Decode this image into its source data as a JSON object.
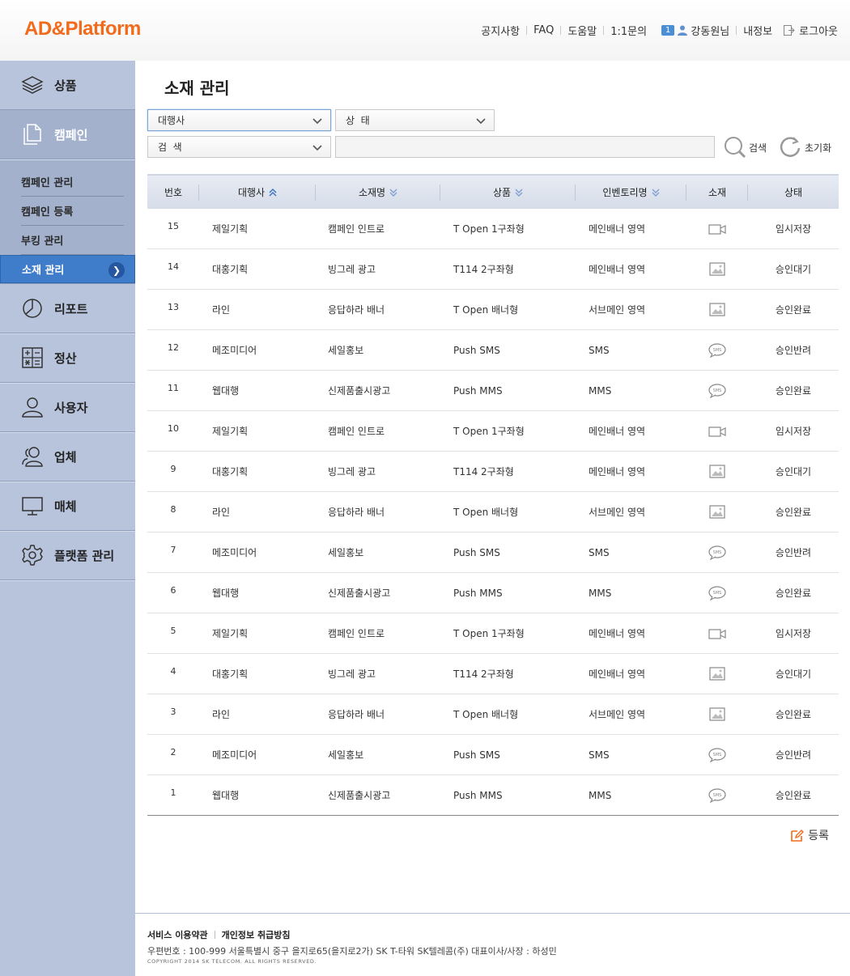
{
  "logo": "AD&Platform",
  "topnav": {
    "notice": "공지사항",
    "faq": "FAQ",
    "help": "도움말",
    "inquiry": "1:1문의",
    "badge": "1",
    "user": "강동원님",
    "myinfo": "내정보",
    "logout": "로그아웃"
  },
  "sidebar": {
    "menus": [
      {
        "label": "상품",
        "icon": "layers-icon"
      },
      {
        "label": "캠페인",
        "icon": "documents-icon"
      },
      {
        "label": "리포트",
        "icon": "pie-chart-icon"
      },
      {
        "label": "정산",
        "icon": "calculator-icon"
      },
      {
        "label": "사용자",
        "icon": "user-icon"
      },
      {
        "label": "업체",
        "icon": "users-icon"
      },
      {
        "label": "매체",
        "icon": "monitor-icon"
      },
      {
        "label": "플랫폼 관리",
        "icon": "gear-icon"
      }
    ],
    "submenu": [
      "캠페인 관리",
      "캠페인 등록",
      "부킹 관리",
      "소재 관리"
    ]
  },
  "page_title": "소재 관리",
  "filters": {
    "agency": "대행사",
    "status": "상  태",
    "search_type": "검  색",
    "search_value": "",
    "search_label": "검색",
    "reset_label": "초기화"
  },
  "table": {
    "headers": [
      "번호",
      "대행사",
      "소재명",
      "상품",
      "인벤토리명",
      "소재",
      "상태"
    ],
    "rows": [
      {
        "no": "15",
        "agency": "제일기획",
        "name": "캠페인 인트로",
        "product": "T Open 1구좌형",
        "inventory": "메인배너 영역",
        "media": "video",
        "status": "임시저장"
      },
      {
        "no": "14",
        "agency": "대홍기획",
        "name": "빙그레 광고",
        "product": "T114 2구좌형",
        "inventory": "메인배너 영역",
        "media": "image",
        "status": "승인대기"
      },
      {
        "no": "13",
        "agency": "라인",
        "name": "응답하라 배너",
        "product": "T Open 배너형",
        "inventory": "서브메인 영역",
        "media": "image",
        "status": "승인완료"
      },
      {
        "no": "12",
        "agency": "메조미디어",
        "name": "세일홍보",
        "product": "Push SMS",
        "inventory": "SMS",
        "media": "sms",
        "status": "승인반려"
      },
      {
        "no": "11",
        "agency": "웹대행",
        "name": "신제품출시광고",
        "product": "Push MMS",
        "inventory": "MMS",
        "media": "sms",
        "status": "승인완료"
      },
      {
        "no": "10",
        "agency": "제일기획",
        "name": "캠페인 인트로",
        "product": "T Open 1구좌형",
        "inventory": "메인배너 영역",
        "media": "video",
        "status": "임시저장"
      },
      {
        "no": "9",
        "agency": "대홍기획",
        "name": "빙그레 광고",
        "product": "T114 2구좌형",
        "inventory": "메인배너 영역",
        "media": "image",
        "status": "승인대기"
      },
      {
        "no": "8",
        "agency": "라인",
        "name": "응답하라 배너",
        "product": "T Open 배너형",
        "inventory": "서브메인 영역",
        "media": "image",
        "status": "승인완료"
      },
      {
        "no": "7",
        "agency": "메조미디어",
        "name": "세일홍보",
        "product": "Push SMS",
        "inventory": "SMS",
        "media": "sms",
        "status": "승인반려"
      },
      {
        "no": "6",
        "agency": "웹대행",
        "name": "신제품출시광고",
        "product": "Push MMS",
        "inventory": "MMS",
        "media": "sms",
        "status": "승인완료"
      },
      {
        "no": "5",
        "agency": "제일기획",
        "name": "캠페인 인트로",
        "product": "T Open 1구좌형",
        "inventory": "메인배너 영역",
        "media": "video",
        "status": "임시저장"
      },
      {
        "no": "4",
        "agency": "대홍기획",
        "name": "빙그레 광고",
        "product": "T114 2구좌형",
        "inventory": "메인배너 영역",
        "media": "image",
        "status": "승인대기"
      },
      {
        "no": "3",
        "agency": "라인",
        "name": "응답하라 배너",
        "product": "T Open 배너형",
        "inventory": "서브메인 영역",
        "media": "image",
        "status": "승인완료"
      },
      {
        "no": "2",
        "agency": "메조미디어",
        "name": "세일홍보",
        "product": "Push SMS",
        "inventory": "SMS",
        "media": "sms",
        "status": "승인반려"
      },
      {
        "no": "1",
        "agency": "웹대행",
        "name": "신제품출시광고",
        "product": "Push MMS",
        "inventory": "MMS",
        "media": "sms",
        "status": "승인완료"
      }
    ]
  },
  "register_label": "등록",
  "footer": {
    "terms": "서비스 이용약관",
    "privacy": "개인정보 취급방침",
    "address": "우편번호 : 100-999 서울특별시 중구 을지로65(을지로2가) SK T-타워 SK텔레콤(주) 대표이사/사장 : 하성민",
    "copyright": "COPYRIGHT 2014 SK TELECOM. ALL RIGHTS RESERVED."
  },
  "colors": {
    "brand": "#f26b1d",
    "sidebar_bg": "#b8c4dc",
    "active_blue": "#3f7cc9"
  }
}
